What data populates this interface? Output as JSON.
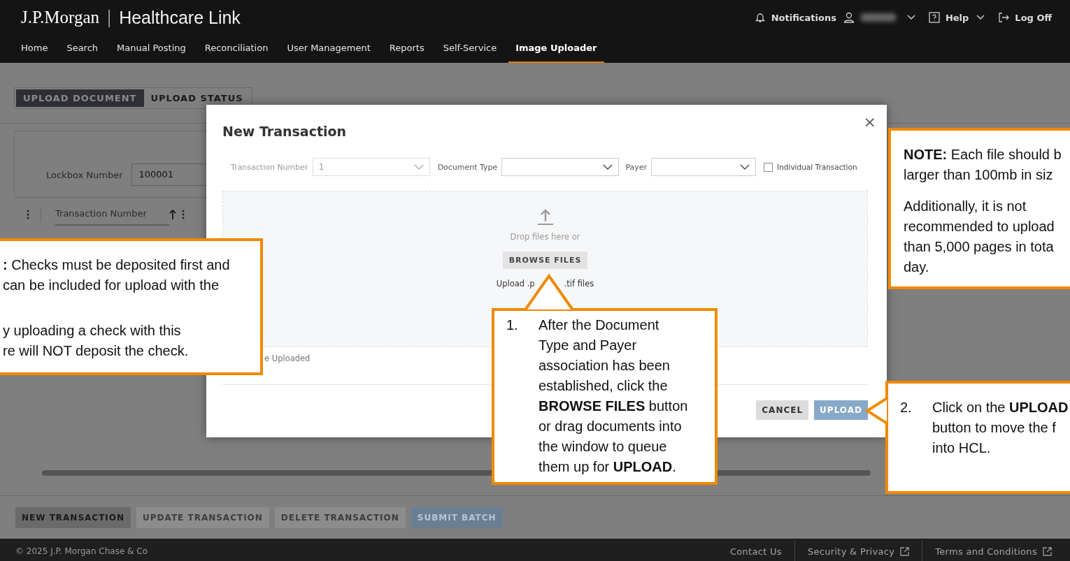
{
  "header": {
    "logo": "J.P.Morgan",
    "separator": "|",
    "product": "Healthcare Link",
    "notifications": "Notifications",
    "help": "Help",
    "logoff": "Log Off"
  },
  "nav": [
    {
      "label": "Home",
      "selected": false
    },
    {
      "label": "Search",
      "selected": false
    },
    {
      "label": "Manual Posting",
      "selected": false
    },
    {
      "label": "Reconciliation",
      "selected": false
    },
    {
      "label": "User Management",
      "selected": false
    },
    {
      "label": "Reports",
      "selected": false
    },
    {
      "label": "Self-Service",
      "selected": false
    },
    {
      "label": "Image Uploader",
      "selected": true
    }
  ],
  "page_tabs": [
    {
      "label": "UPLOAD DOCUMENT",
      "selected": true
    },
    {
      "label": "UPLOAD STATUS",
      "selected": false
    }
  ],
  "lockbox": {
    "label": "Lockbox Number",
    "value": "100001"
  },
  "table": {
    "columns": [
      "Transaction Number"
    ]
  },
  "action_buttons": [
    {
      "label": "NEW TRANSACTION",
      "disabled": false,
      "primary": true
    },
    {
      "label": "UPDATE TRANSACTION",
      "disabled": false,
      "primary": false
    },
    {
      "label": "DELETE TRANSACTION",
      "disabled": false,
      "primary": false
    },
    {
      "label": "SUBMIT BATCH",
      "disabled": true,
      "primary": false
    }
  ],
  "footer": {
    "copyright": "© 2025 J.P. Morgan Chase & Co",
    "links": [
      "Contact Us",
      "Security & Privacy",
      "Terms and Conditions"
    ]
  },
  "modal": {
    "title": "New Transaction",
    "close": "×",
    "fields": [
      {
        "label": "Transaction Number",
        "value": "1",
        "disabled": true
      },
      {
        "label": "Document Type",
        "disabled": false
      },
      {
        "label": "Payer",
        "disabled": false
      }
    ],
    "individual_transaction": {
      "label": "Individual Transaction",
      "checked": false
    },
    "dropzone": {
      "hint": "Drop files here or",
      "browse": "BROWSE FILES",
      "types": [
        "Upload .p",
        ".tif files"
      ]
    },
    "uploaded_label": "e Uploaded",
    "buttons": [
      {
        "label": "CANCEL",
        "disabled": false
      },
      {
        "label": "UPLOAD",
        "disabled": true
      }
    ]
  },
  "callouts": [
    {
      "kind": "note",
      "paragraphs": [
        [
          "**:** Checks must be deposited first and",
          "can be included for upload with the"
        ],
        [
          "y uploading a check with this",
          "re will NOT deposit the check."
        ]
      ]
    },
    {
      "kind": "step",
      "number": "1.",
      "text": "After the Document Type and Payer association has been established, click the **BROWSE FILES** button or drag documents into the window to queue them up for **UPLOAD**."
    },
    {
      "kind": "note",
      "paragraphs": [
        [
          "**NOTE:** Each file should b",
          "larger than 100mb in siz"
        ],
        [
          "Additionally, it is not",
          "recommended to upload",
          "than 5,000 pages in tota",
          "day."
        ]
      ]
    },
    {
      "kind": "step",
      "number": "2.",
      "lines": [
        "Click on the **UPLOAD**",
        "button to move the f",
        "into HCL."
      ]
    }
  ]
}
